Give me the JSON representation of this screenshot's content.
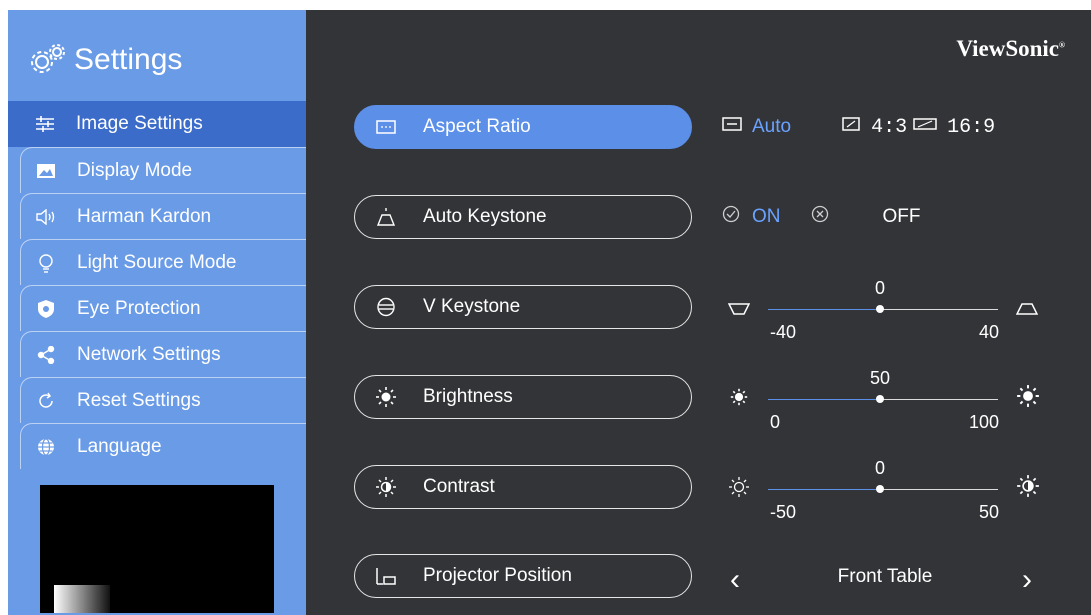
{
  "sidebar": {
    "title": "Settings",
    "items": [
      {
        "label": "Image Settings",
        "icon": "sliders-icon",
        "active": true
      },
      {
        "label": "Display Mode",
        "icon": "picture-icon"
      },
      {
        "label": "Harman Kardon",
        "icon": "speaker-icon"
      },
      {
        "label": "Light Source Mode",
        "icon": "lightbulb-icon"
      },
      {
        "label": "Eye Protection",
        "icon": "eye-shield-icon"
      },
      {
        "label": "Network Settings",
        "icon": "share-icon"
      },
      {
        "label": "Reset Settings",
        "icon": "reset-icon"
      },
      {
        "label": "Language",
        "icon": "globe-icon"
      }
    ]
  },
  "brand": "ViewSonic",
  "settings": {
    "aspect_ratio": {
      "label": "Aspect Ratio",
      "options": [
        "Auto",
        "4:3",
        "16:9"
      ],
      "selected": "Auto"
    },
    "auto_keystone": {
      "label": "Auto Keystone",
      "on_label": "ON",
      "off_label": "OFF",
      "selected": "ON"
    },
    "v_keystone": {
      "label": "V Keystone",
      "value": "0",
      "min": "-40",
      "max": "40"
    },
    "brightness": {
      "label": "Brightness",
      "value": "50",
      "min": "0",
      "max": "100"
    },
    "contrast": {
      "label": "Contrast",
      "value": "0",
      "min": "-50",
      "max": "50"
    },
    "projector_position": {
      "label": "Projector Position",
      "value": "Front Table"
    }
  },
  "colors": {
    "sidebar": "#6a9be6",
    "sidebar_active": "#3c6cc9",
    "main_bg": "#333437",
    "accent": "#5b8fe8",
    "selected_text": "#6aa2ff"
  }
}
